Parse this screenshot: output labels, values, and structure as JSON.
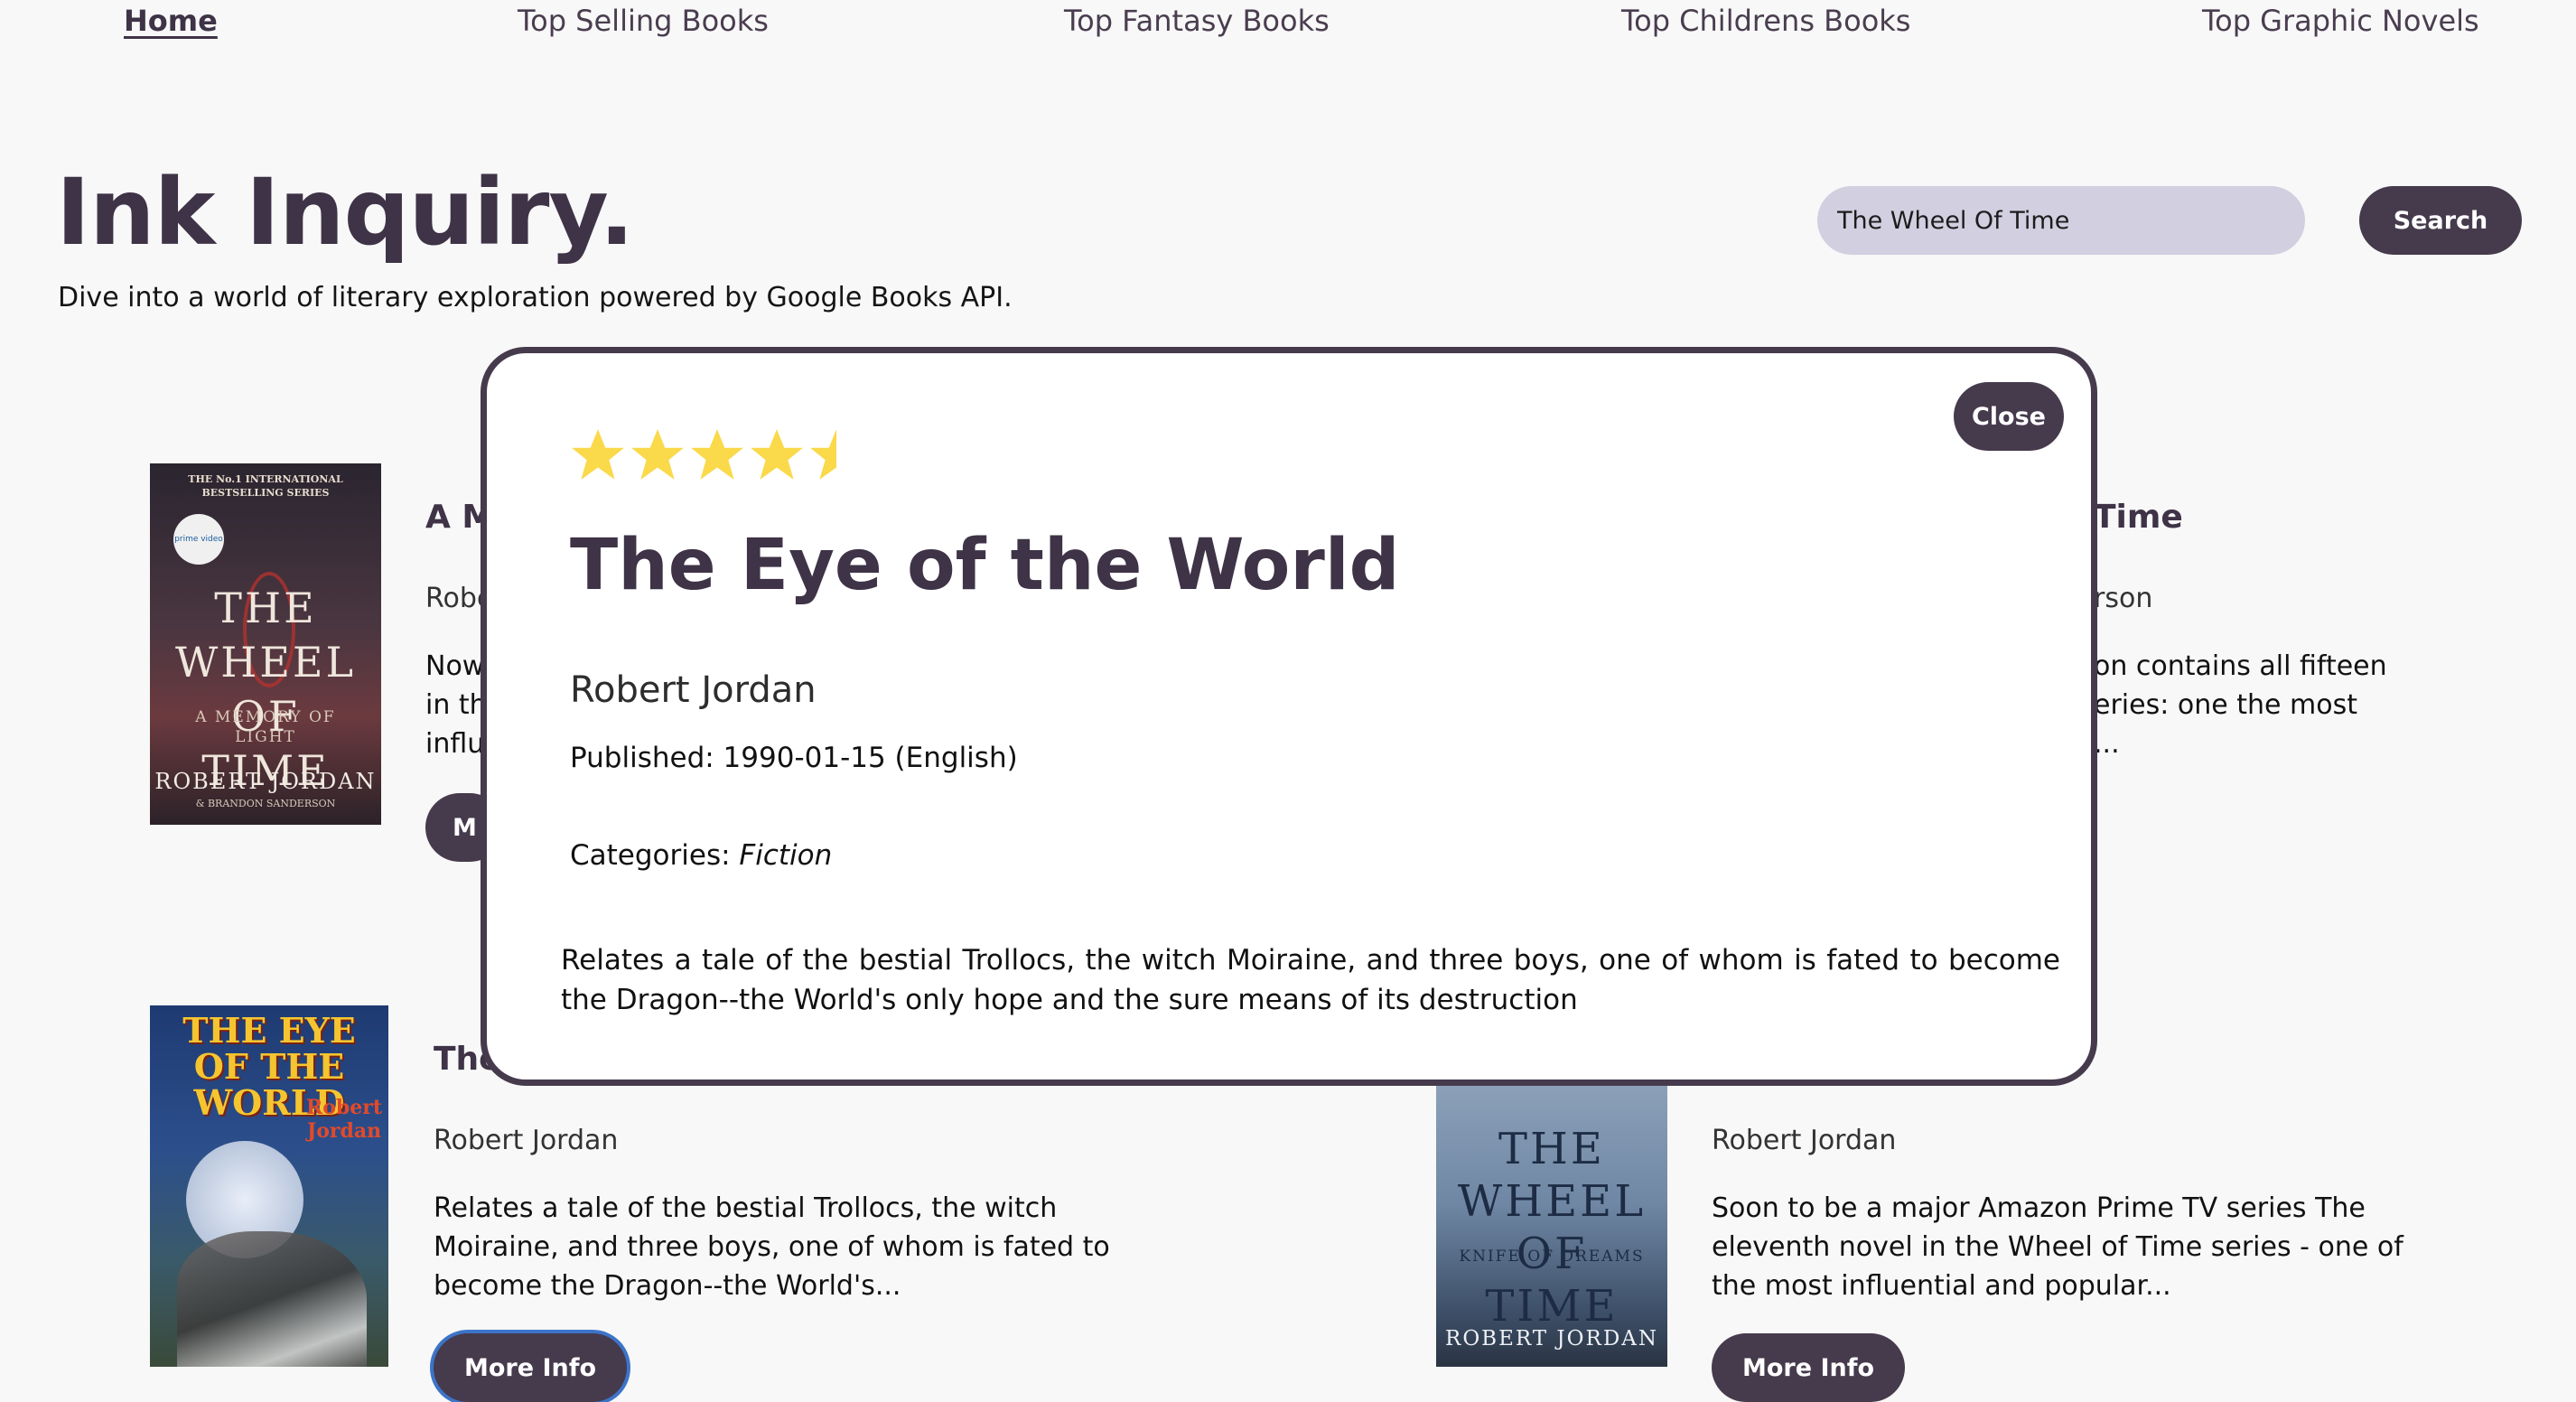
{
  "nav": {
    "items": [
      "Home",
      "Top Selling Books",
      "Top Fantasy Books",
      "Top Childrens Books",
      "Top Graphic Novels"
    ]
  },
  "header": {
    "brand": "Ink Inquiry.",
    "tagline": "Dive into a world of literary exploration powered by Google Books API."
  },
  "search": {
    "value": "The Wheel Of Time",
    "button_label": "Search"
  },
  "cards": [
    {
      "title": "A M",
      "author": "Robe",
      "description_lines": [
        "Now",
        "in th",
        "influ"
      ],
      "button_label": "M",
      "cover": {
        "top_line": "THE No.1 INTERNATIONAL BESTSELLING SERIES",
        "badge": "prime video",
        "series": "THE WHEEL OF TIME",
        "subtitle": "A MEMORY OF LIGHT",
        "author": "ROBERT JORDAN",
        "coauthor": "& BRANDON SANDERSON"
      }
    },
    {
      "title": "Time",
      "author": "rson",
      "description_lines": [
        "on contains all fifteen",
        "eries: one the most",
        "..."
      ]
    },
    {
      "title": "The",
      "author": "Robert Jordan",
      "description": "Relates a tale of the bestial Trollocs, the witch Moiraine, and three boys, one of whom is fated to become the Dragon--the World's...",
      "button_label": "More Info",
      "cover": {
        "title": "THE EYE OF THE WORLD",
        "author": "Robert Jordan"
      }
    },
    {
      "author": "Robert Jordan",
      "description": "Soon to be a major Amazon Prime TV series The eleventh novel in the Wheel of Time series - one of the most influential and popular...",
      "button_label": "More Info",
      "cover": {
        "series": "THE WHEEL OF TIME",
        "subtitle": "KNIFE OF DREAMS",
        "author": "ROBERT JORDAN"
      }
    }
  ],
  "modal": {
    "close_label": "Close",
    "rating": 4.5,
    "rating_max": 5,
    "star_color": "#fad94a",
    "title": "The Eye of the World",
    "author": "Robert Jordan",
    "published": "Published: 1990-01-15 (English)",
    "categories_label": "Categories:",
    "categories_value": "Fiction",
    "description": "Relates a tale of the bestial Trollocs, the witch Moiraine, and three boys, one of whom is fated to become the Dragon--the World's only hope and the sure means of its destruction"
  },
  "colors": {
    "accent": "#463a4d",
    "search_bg": "#d2cfe0",
    "page_bg": "#f7f8f7"
  }
}
